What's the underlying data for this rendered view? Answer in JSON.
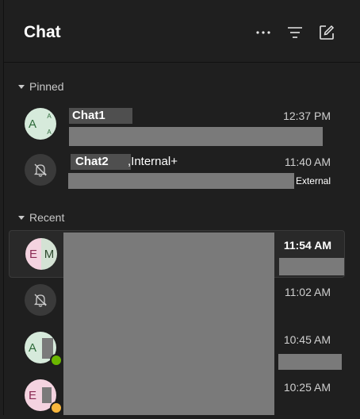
{
  "header": {
    "title": "Chat",
    "more_icon": "more-horizontal-icon",
    "filter_icon": "filter-icon",
    "compose_icon": "new-chat-icon"
  },
  "sections": {
    "pinned": "Pinned",
    "recent": "Recent"
  },
  "pinned": [
    {
      "name": "Chat1",
      "avatar_initials": [
        "A",
        "A",
        "A"
      ],
      "time": "12:37 PM"
    },
    {
      "name": "Chat2",
      "suffix": ",Internal+",
      "time": "11:40 AM",
      "tag": "External",
      "avatar_icon": "muted-bell-icon"
    }
  ],
  "recent": [
    {
      "avatar_initials": [
        "E",
        "M"
      ],
      "time": "11:54 AM",
      "unread": true
    },
    {
      "avatar_icon": "muted-bell-icon",
      "time": "11:02 AM"
    },
    {
      "avatar_initials": [
        "A"
      ],
      "time": "10:45 AM",
      "presence": "available"
    },
    {
      "avatar_initials": [
        "E"
      ],
      "time": "10:25 AM",
      "presence": "away"
    }
  ],
  "colors": {
    "background": "#1f1f1f",
    "redaction": "#7a7a7a",
    "available": "#6bb700",
    "away": "#f8b73d"
  }
}
